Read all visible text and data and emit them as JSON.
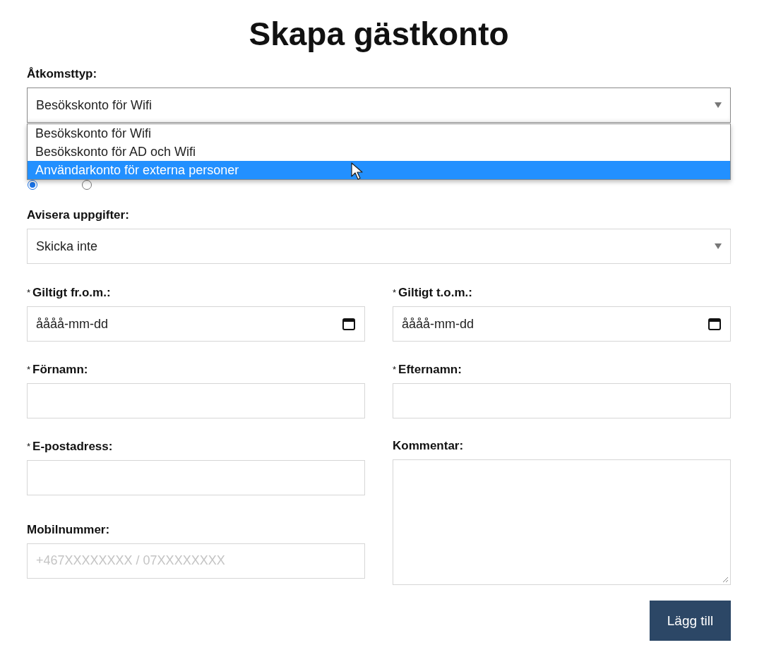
{
  "title": "Skapa gästkonto",
  "access_type": {
    "label": "Åtkomsttyp:",
    "value": "Besökskonto för Wifi",
    "expanded": true,
    "options": [
      {
        "label": "Besökskonto för Wifi",
        "highlighted": false
      },
      {
        "label": "Besökskonto för AD och Wifi",
        "highlighted": false
      },
      {
        "label": "Användarkonto för externa personer",
        "highlighted": true
      }
    ]
  },
  "count_radios": [
    {
      "selected": true
    },
    {
      "selected": false
    }
  ],
  "notify": {
    "label": "Avisera uppgifter:",
    "value": "Skicka inte"
  },
  "fields": [
    {
      "kind": "date",
      "marker": "*",
      "label": "Giltigt fr.o.m.:",
      "placeholder": "åååå-mm-dd"
    },
    {
      "kind": "date",
      "marker": "*",
      "label": "Giltigt t.o.m.:",
      "placeholder": "åååå-mm-dd"
    },
    {
      "kind": "text",
      "marker": "*",
      "label": "Förnamn:"
    },
    {
      "kind": "text",
      "marker": "*",
      "label": "Efternamn:"
    },
    {
      "kind": "text",
      "marker": "*",
      "label": "E-postadress:"
    },
    {
      "kind": "textarea",
      "label": "Kommentar:"
    },
    {
      "kind": "text",
      "label": "Mobilnummer:",
      "placeholder": "+467XXXXXXXX / 07XXXXXXXX"
    }
  ],
  "submit": "Lägg till"
}
